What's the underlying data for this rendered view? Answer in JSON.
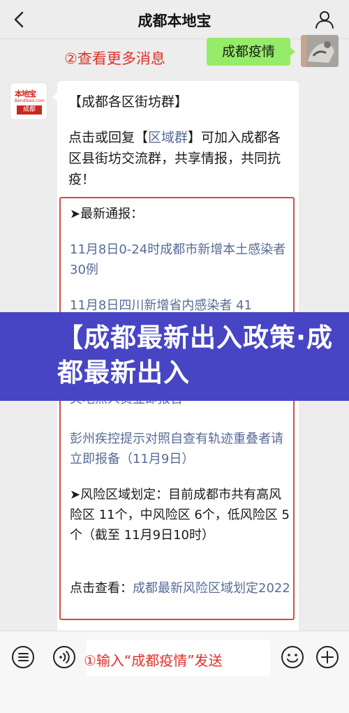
{
  "header": {
    "title": "成都本地宝"
  },
  "annotations": {
    "view_more": "②查看更多消息",
    "input_hint": "①输入“成都疫情”发送"
  },
  "sent_message": {
    "text": "成都疫情"
  },
  "bot_avatar": {
    "logo_top": "本地宝",
    "logo_sub": "Bendibao.com",
    "logo_city": "成都"
  },
  "reply": {
    "header": "【成都各区街坊群】",
    "intro_pre": "点击或回复【",
    "intro_link": "区域群",
    "intro_post": "】可加入成都各区县街坊交流群，共享情报，共同抗疫！",
    "section_title": "➤最新通报：",
    "news_1": "11月8日0-24时成都市新增本土感染者 30例",
    "news_2": "11月8日四川新增省内感染者 41",
    "news_3": "关地点人员立即报告",
    "pengzhou": "彭州疾控提示对照自查有轨迹重叠者请立即报备（11月9日）",
    "risk": "➤风险区域划定：目前成都市共有高风险区 11个，中风险区 6个，低风险区 5个（截至 11月9日10时）",
    "click_pre": "点击查看：",
    "click_link": "成都最新风险区域划定2022"
  },
  "banner": {
    "text": "【成都最新出入政策·成都最新出入"
  },
  "colors": {
    "accent_red": "#e0312a",
    "link_blue": "#576b95",
    "sent_green": "#95ec69",
    "banner_purple": "#4745c4"
  }
}
